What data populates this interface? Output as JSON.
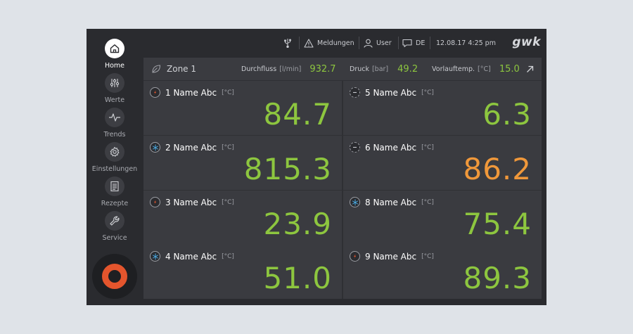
{
  "sidebar": {
    "items": [
      {
        "label": "Home",
        "icon": "home-icon",
        "active": true
      },
      {
        "label": "Werte",
        "icon": "sliders-icon"
      },
      {
        "label": "Trends",
        "icon": "trend-icon"
      },
      {
        "label": "Einstellungen",
        "icon": "gear-icon"
      },
      {
        "label": "Rezepte",
        "icon": "recipe-icon"
      },
      {
        "label": "Service",
        "icon": "wrench-icon"
      }
    ],
    "power_button": {
      "icon": "power-ring-icon",
      "color": "#e4552d"
    }
  },
  "topbar": {
    "messages": "Meldungen",
    "user": "User",
    "language": "DE",
    "datetime": "12.08.17 4:25 pm",
    "logo": "gwk"
  },
  "zone": {
    "title": "Zone 1",
    "flow": {
      "label": "Durchfluss",
      "unit": "[l/min]",
      "value": "932.7"
    },
    "pressure": {
      "label": "Druck",
      "unit": "[bar]",
      "value": "49.2"
    },
    "supply_temp": {
      "label": "Vorlauftemp.",
      "unit": "[°C]",
      "value": "15.0"
    }
  },
  "tiles": [
    {
      "name": "1 Name Abc",
      "unit": "[°C]",
      "value": "84.7",
      "mode": "heat"
    },
    {
      "name": "5 Name Abc",
      "unit": "[°C]",
      "value": "6.3",
      "mode": "off"
    },
    {
      "name": "2 Name Abc",
      "unit": "[°C]",
      "value": "815.3",
      "mode": "cool"
    },
    {
      "name": "6 Name Abc",
      "unit": "[°C]",
      "value": "86.2",
      "mode": "off",
      "warning": true
    },
    {
      "name": "3 Name Abc",
      "unit": "[°C]",
      "value": "23.9",
      "mode": "heat"
    },
    {
      "name": "8 Name Abc",
      "unit": "[°C]",
      "value": "75.4",
      "mode": "cool"
    },
    {
      "name": "4 Name Abc",
      "unit": "[°C]",
      "value": "51.0",
      "mode": "cool"
    },
    {
      "name": "9 Name Abc",
      "unit": "[°C]",
      "value": "89.3",
      "mode": "heat"
    }
  ],
  "colors": {
    "ok": "#8dc63f",
    "warning": "#f0983a",
    "heat": "#e4552d",
    "cool": "#4aa8e0"
  }
}
